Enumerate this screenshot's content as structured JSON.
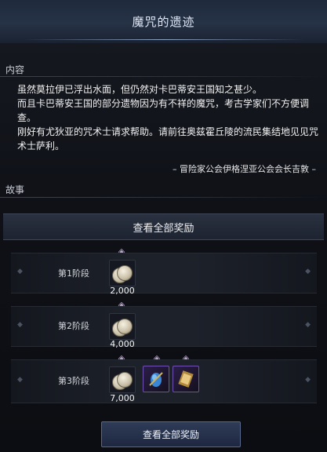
{
  "window": {
    "title": "魔咒的遗迹"
  },
  "content_section": {
    "header": "内容",
    "paragraphs": [
      "虽然莫拉伊已浮出水面，但仍然对卡巴蒂安王国知之甚少。",
      "而且卡巴蒂安王国的部分遗物因为有不祥的魔咒，考古学家们不方便调查。",
      "刚好有尤狄亚的咒术士请求帮助。请前往奥兹霍丘陵的流民集结地见见咒术士萨利。"
    ],
    "signature": "– 冒险家公会伊格涅亚公会会长吉敦 –"
  },
  "story_section": {
    "header": "故事"
  },
  "rewards": {
    "header_button": "查看全部奖励",
    "stages": [
      {
        "label": "第1阶段",
        "items": [
          {
            "icon": "silver-coin-icon",
            "qty": "2,000"
          }
        ]
      },
      {
        "label": "第2阶段",
        "items": [
          {
            "icon": "silver-coin-icon",
            "qty": "4,000"
          }
        ]
      },
      {
        "label": "第3阶段",
        "items": [
          {
            "icon": "silver-coin-icon",
            "qty": "7,000"
          },
          {
            "icon": "blue-orb-icon",
            "qty": ""
          },
          {
            "icon": "gold-card-icon",
            "qty": ""
          }
        ]
      }
    ]
  },
  "footer": {
    "button": "查看全部奖励"
  }
}
